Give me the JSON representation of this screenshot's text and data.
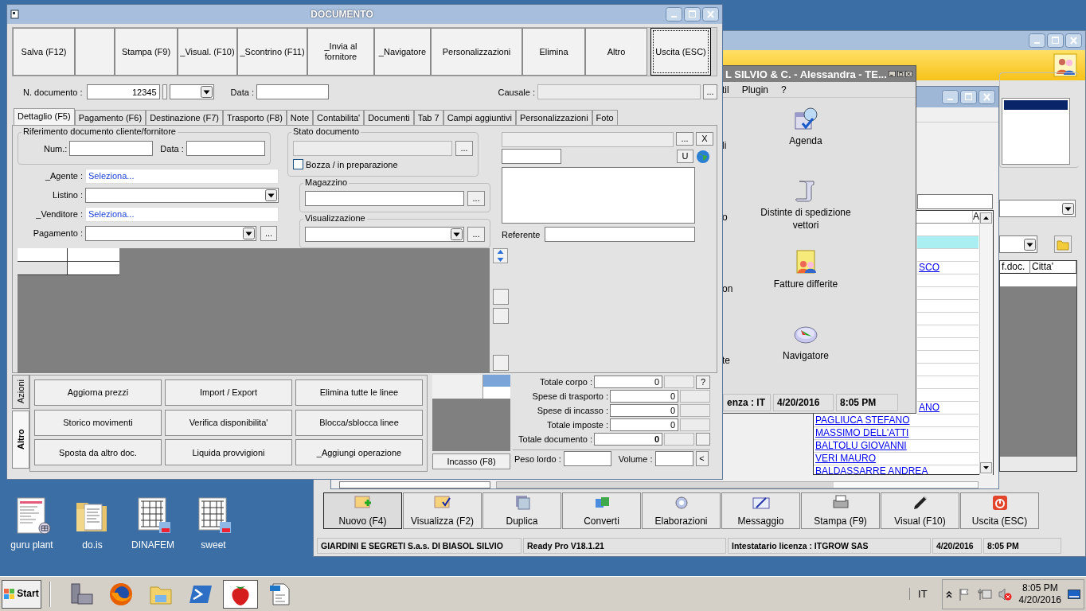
{
  "document_window": {
    "title": "DOCUMENTO",
    "toolbar": [
      {
        "kind": "button",
        "label": "Salva (F12)",
        "focused": false
      },
      {
        "kind": "blank"
      },
      {
        "kind": "button",
        "label": "Stampa (F9)",
        "focused": false
      },
      {
        "kind": "button",
        "label": "_Visual. (F10)",
        "focused": false
      },
      {
        "kind": "button",
        "label": "_Scontrino (F11)",
        "focused": false
      },
      {
        "kind": "button",
        "label": "_Invia al fornitore",
        "focused": false
      },
      {
        "kind": "button",
        "label": "_Navigatore",
        "focused": false
      },
      {
        "kind": "button",
        "label": "Personalizzazioni",
        "focused": false
      },
      {
        "kind": "button",
        "label": "Elimina",
        "focused": false
      },
      {
        "kind": "button",
        "label": "Altro",
        "focused": false
      },
      {
        "kind": "button",
        "label": "Uscita (ESC)",
        "focused": true
      }
    ],
    "header": {
      "number_label": "N. documento :",
      "number": "12345",
      "date_label": "Data :",
      "reason_label": "Causale :",
      "reason_button": "..."
    },
    "tabs": [
      {
        "label": "Dettaglio (F5)",
        "selected": true
      },
      {
        "label": "Pagamento (F6)",
        "selected": false
      },
      {
        "label": "Destinazione (F7)",
        "selected": false
      },
      {
        "label": "Trasporto (F8)",
        "selected": false
      },
      {
        "label": "Note",
        "selected": false
      },
      {
        "label": "Contabilita'",
        "selected": false
      },
      {
        "label": "Documenti",
        "selected": false
      },
      {
        "label": "Tab 7",
        "selected": false
      },
      {
        "label": "Campi aggiuntivi",
        "selected": false
      },
      {
        "label": "Personalizzazioni",
        "selected": false
      },
      {
        "label": "Foto",
        "selected": false
      }
    ],
    "reference_group": {
      "title": "Riferimento documento cliente/fornitore",
      "num_label": "Num.:",
      "date_label": "Data :"
    },
    "fields": [
      {
        "kind": "link",
        "label": "_Agente :",
        "value": "Seleziona..."
      },
      {
        "kind": "combo",
        "label": "Listino :"
      },
      {
        "kind": "link",
        "label": "_Venditore :",
        "value": "Seleziona..."
      },
      {
        "kind": "combo_button",
        "label": "Pagamento :",
        "button": "..."
      }
    ],
    "status_group": {
      "title": "Stato documento",
      "button": "...",
      "draft_label": "Bozza / in preparazione",
      "draft_checked": false
    },
    "warehouse_group": {
      "title": "Magazzino",
      "button": "..."
    },
    "view_group": {
      "title": "Visualizzazione",
      "button": "..."
    },
    "contact": {
      "button_more": "...",
      "button_clear": "X",
      "button_u": "U",
      "referente_label": "Referente"
    },
    "side_tabs": [
      {
        "label": "Azioni",
        "selected": false
      },
      {
        "label": "Altro",
        "selected": true
      }
    ],
    "actions": [
      "Aggiorna prezzi",
      "Import / Export",
      "Elimina tutte le linee",
      "Storico movimenti",
      "Verifica disponibilita'",
      "Blocca/sblocca linee",
      "Sposta da altro doc.",
      "Liquida provvigioni",
      "_Aggiungi operazione"
    ],
    "incasso_button": "Incasso (F8)",
    "totals": [
      {
        "label": "Totale corpo :",
        "value": "0",
        "bold": false
      },
      {
        "label": "Spese di trasporto :",
        "value": "0",
        "bold": false
      },
      {
        "label": "Spese di incasso :",
        "value": "0",
        "bold": false
      },
      {
        "label": "Totale imposte :",
        "value": "0",
        "bold": false
      },
      {
        "label": "Totale documento :",
        "value": "0",
        "bold": true
      }
    ],
    "help_button": "?",
    "weight_label": "Peso lordo :",
    "volume_label": "Volume :",
    "prev_button": "<"
  },
  "launcher_window": {
    "title": "L SILVIO & C. - Alessandra - TE...",
    "menu": [
      "til",
      "Plugin",
      "?"
    ],
    "cut_labels": [
      "li",
      "o",
      "on",
      "te"
    ],
    "launchers": [
      {
        "label": "Agenda",
        "kind": "agenda"
      },
      {
        "label": "Distinte di spedizione vettori",
        "kind": "scroll"
      },
      {
        "label": "Fatture differite",
        "kind": "invoice"
      },
      {
        "label": "Navigatore",
        "kind": "compass"
      }
    ],
    "status_bar": [
      "enza : IT",
      "4/20/2016",
      "8:05 PM"
    ]
  },
  "list_window": {
    "column": "A",
    "rows": [
      {
        "selected": false
      },
      {
        "selected": true
      },
      {
        "selected": false
      },
      {
        "selected": false,
        "text": "SCO"
      },
      {
        "selected": false
      },
      {
        "selected": false
      },
      {
        "selected": false
      },
      {
        "selected": false
      },
      {
        "selected": false
      },
      {
        "selected": false
      },
      {
        "selected": false
      },
      {
        "selected": false
      },
      {
        "selected": false
      },
      {
        "selected": false
      },
      {
        "selected": false,
        "text": "ANO"
      },
      {
        "selected": false,
        "text": "PAGLIUCA STEFANO"
      },
      {
        "selected": false,
        "text": "MASSIMO DELL'ATTI"
      },
      {
        "selected": false,
        "text": "BALTOLU GIOVANNI"
      },
      {
        "selected": false,
        "text": "VERI MAURO"
      },
      {
        "selected": false,
        "text": "BALDASSARRE ANDREA"
      }
    ]
  },
  "main_window": {
    "grid_columns": [
      "f.doc.",
      "Citta'"
    ],
    "toolbar": [
      {
        "label": "Nuovo (F4)",
        "kind": "new",
        "selected": true
      },
      {
        "label": "Visualizza (F2)",
        "kind": "view",
        "selected": false
      },
      {
        "label": "Duplica",
        "kind": "copy",
        "selected": false
      },
      {
        "label": "Converti",
        "kind": "convert",
        "selected": false
      },
      {
        "label": "Elaborazioni",
        "kind": "gear",
        "selected": false
      },
      {
        "label": "Messaggio",
        "kind": "mail",
        "selected": false
      },
      {
        "label": "Stampa (F9)",
        "kind": "print",
        "selected": false
      },
      {
        "label": "Visual (F10)",
        "kind": "pen",
        "selected": false
      },
      {
        "label": "Uscita (ESC)",
        "kind": "exit",
        "selected": false
      }
    ],
    "status_bar": [
      "GIARDINI E SEGRETI S.a.s. DI BIASOL SILVIO",
      "Ready Pro V18.1.21",
      "Intestatario licenza : ITGROW SAS",
      "4/20/2016",
      "8:05 PM"
    ]
  },
  "desktop_icons": [
    {
      "label": "guru plant",
      "kind": "sheet"
    },
    {
      "label": "do.is",
      "kind": "folder"
    },
    {
      "label": "DINAFEM",
      "kind": "pdfgrid"
    },
    {
      "label": "sweet",
      "kind": "pdfgrid"
    }
  ],
  "taskbar": {
    "start": "Start",
    "apps": [
      {
        "kind": "toolbox",
        "selected": false
      },
      {
        "kind": "firefox",
        "selected": false
      },
      {
        "kind": "explorer",
        "selected": false
      },
      {
        "kind": "powershell",
        "selected": false
      },
      {
        "kind": "strawberry",
        "selected": true
      },
      {
        "kind": "odf",
        "selected": false
      }
    ],
    "language": "IT",
    "time": "8:05 PM",
    "date": "4/20/2016"
  }
}
